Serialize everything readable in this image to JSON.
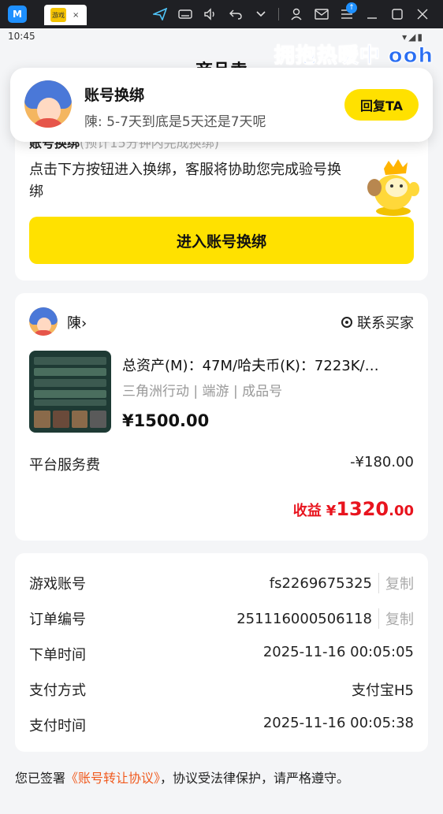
{
  "emulator": {
    "logo_text": "M",
    "tab_thumb_text": "游戏",
    "tab_close": "×",
    "icons": [
      "paper-plane-icon",
      "keyboard-icon",
      "volume-icon",
      "back-icon",
      "chevron-down-icon",
      "user-icon",
      "mail-icon",
      "menu-icon",
      "minimize-icon",
      "maximize-icon",
      "close-icon"
    ],
    "update_badge": "↑"
  },
  "status_bar": {
    "time": "10:45",
    "icons_text": "▾◢▮"
  },
  "watermark": "拥抱热暖中 ooh",
  "page": {
    "title": "商品卖"
  },
  "notification": {
    "title": "账号换绑",
    "message": "陳: 5-7天到底是5天还是7天呢",
    "reply_label": "回复TA"
  },
  "rebind_card": {
    "subtitle": "账号换绑",
    "subtitle_note": "(预计15分钟内完成换绑)",
    "description": "点击下方按钮进入换绑，客服将协助您完成验号换绑",
    "button_label": "进入账号换绑"
  },
  "order_card": {
    "seller_name": "陳›",
    "contact_label": "联系买家",
    "product_title": "总资产(M)：47M/哈夫币(K)：7223K/…",
    "product_meta": "三角洲行动 | 端游 | 成品号",
    "price": "¥1500.00",
    "fee_label": "平台服务费",
    "fee_value": "-¥180.00",
    "income_label": "收益",
    "income_currency": "¥",
    "income_int": "1320",
    "income_dec": ".00"
  },
  "info_card": {
    "rows": [
      {
        "key": "游戏账号",
        "value": "fs2269675325",
        "copy": "复制"
      },
      {
        "key": "订单编号",
        "value": "251116000506118",
        "copy": "复制"
      },
      {
        "key": "下单时间",
        "value": "2025-11-16 00:05:05"
      },
      {
        "key": "支付方式",
        "value": "支付宝H5"
      },
      {
        "key": "支付时间",
        "value": "2025-11-16 00:05:38"
      }
    ]
  },
  "footer": {
    "prefix": "您已签署",
    "link": "《账号转让协议》",
    "suffix": "，协议受法律保护，请严格遵守。"
  }
}
